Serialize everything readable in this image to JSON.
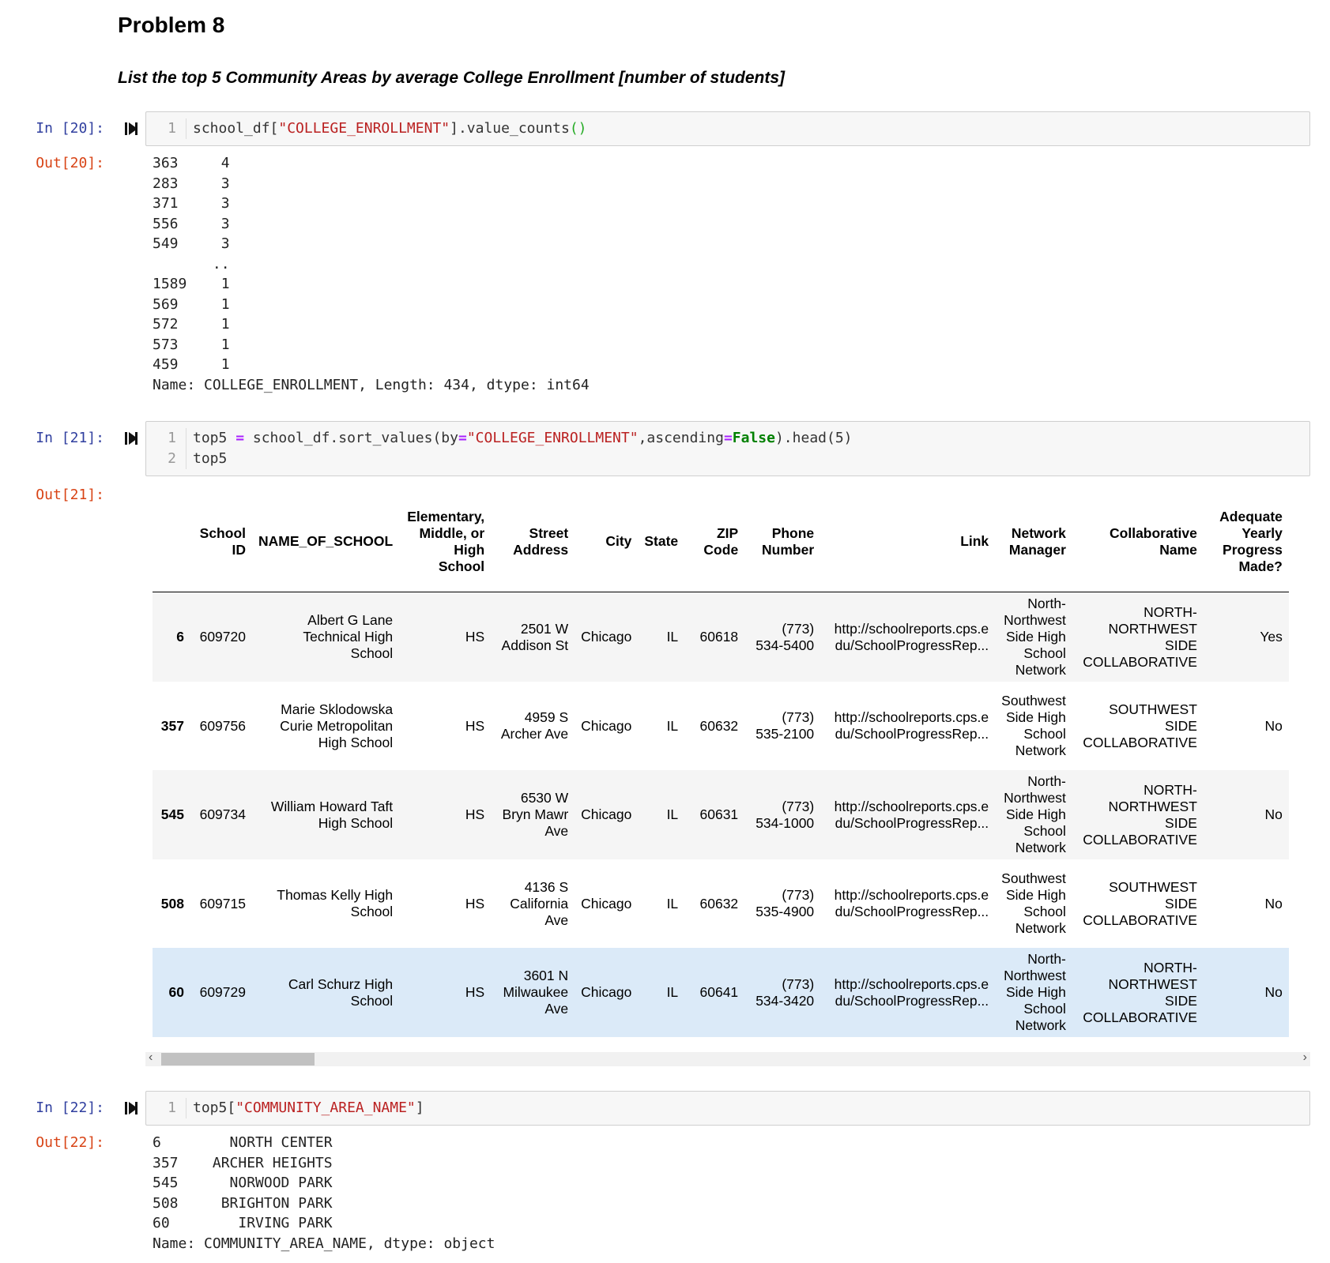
{
  "markdown": {
    "heading": "Problem 8",
    "subheading": "List the top 5 Community Areas by average College Enrollment [number of students]"
  },
  "cells": [
    {
      "in_prompt": "In [20]:",
      "out_prompt": "Out[20]:",
      "code": [
        {
          "no": "1",
          "parts": [
            {
              "t": "school_df[",
              "c": ""
            },
            {
              "t": "\"COLLEGE_ENROLLMENT\"",
              "c": "s"
            },
            {
              "t": "].value_counts",
              "c": ""
            },
            {
              "t": "()",
              "c": "paren"
            }
          ]
        }
      ],
      "output": "363     4\n283     3\n371     3\n556     3\n549     3\n       ..\n1589    1\n569     1\n572     1\n573     1\n459     1\nName: COLLEGE_ENROLLMENT, Length: 434, dtype: int64"
    },
    {
      "in_prompt": "In [21]:",
      "out_prompt": "Out[21]:",
      "code": [
        {
          "no": "1",
          "parts": [
            {
              "t": "top5 ",
              "c": ""
            },
            {
              "t": "=",
              "c": "op"
            },
            {
              "t": " school_df.sort_values(by",
              "c": ""
            },
            {
              "t": "=",
              "c": "op"
            },
            {
              "t": "\"COLLEGE_ENROLLMENT\"",
              "c": "s"
            },
            {
              "t": ",ascending",
              "c": ""
            },
            {
              "t": "=",
              "c": "op"
            },
            {
              "t": "False",
              "c": "kw"
            },
            {
              "t": ").head(5)",
              "c": ""
            }
          ]
        },
        {
          "no": "2",
          "parts": [
            {
              "t": "top5",
              "c": ""
            }
          ]
        }
      ]
    },
    {
      "in_prompt": "In [22]:",
      "out_prompt": "Out[22]:",
      "code": [
        {
          "no": "1",
          "parts": [
            {
              "t": "top5[",
              "c": ""
            },
            {
              "t": "\"COMMUNITY_AREA_NAME\"",
              "c": "s"
            },
            {
              "t": "]",
              "c": ""
            }
          ]
        }
      ],
      "output": "6        NORTH CENTER\n357    ARCHER HEIGHTS\n545      NORWOOD PARK\n508     BRIGHTON PARK\n60        IRVING PARK\nName: COMMUNITY_AREA_NAME, dtype: object"
    }
  ],
  "dataframe": {
    "columns": [
      "",
      "School ID",
      "NAME_OF_SCHOOL",
      "Elementary, Middle, or High School",
      "Street Address",
      "City",
      "State",
      "ZIP Code",
      "Phone Number",
      "Link",
      "Network Manager",
      "Collaborative Name",
      "Adequate Yearly Progress Made?"
    ],
    "rows": [
      [
        "6",
        "609720",
        "Albert G Lane Technical High School",
        "HS",
        "2501 W Addison St",
        "Chicago",
        "IL",
        "60618",
        "(773) 534-5400",
        "http://schoolreports.cps.edu/SchoolProgressRep...",
        "North-Northwest Side High School Network",
        "NORTH-NORTHWEST SIDE COLLABORATIVE",
        "Yes"
      ],
      [
        "357",
        "609756",
        "Marie Sklodowska Curie Metropolitan High School",
        "HS",
        "4959 S Archer Ave",
        "Chicago",
        "IL",
        "60632",
        "(773) 535-2100",
        "http://schoolreports.cps.edu/SchoolProgressRep...",
        "Southwest Side High School Network",
        "SOUTHWEST SIDE COLLABORATIVE",
        "No"
      ],
      [
        "545",
        "609734",
        "William Howard Taft High School",
        "HS",
        "6530 W Bryn Mawr Ave",
        "Chicago",
        "IL",
        "60631",
        "(773) 534-1000",
        "http://schoolreports.cps.edu/SchoolProgressRep...",
        "North-Northwest Side High School Network",
        "NORTH-NORTHWEST SIDE COLLABORATIVE",
        "No"
      ],
      [
        "508",
        "609715",
        "Thomas Kelly High School",
        "HS",
        "4136 S California Ave",
        "Chicago",
        "IL",
        "60632",
        "(773) 535-4900",
        "http://schoolreports.cps.edu/SchoolProgressRep...",
        "Southwest Side High School Network",
        "SOUTHWEST SIDE COLLABORATIVE",
        "No"
      ],
      [
        "60",
        "609729",
        "Carl Schurz High School",
        "HS",
        "3601 N Milwaukee Ave",
        "Chicago",
        "IL",
        "60641",
        "(773) 534-3420",
        "http://schoolreports.cps.edu/SchoolProgressRep...",
        "North-Northwest Side High School Network",
        "NORTH-NORTHWEST SIDE COLLABORATIVE",
        "No"
      ]
    ]
  },
  "scrollbar": {
    "left_arrow": "‹",
    "right_arrow": "›"
  }
}
